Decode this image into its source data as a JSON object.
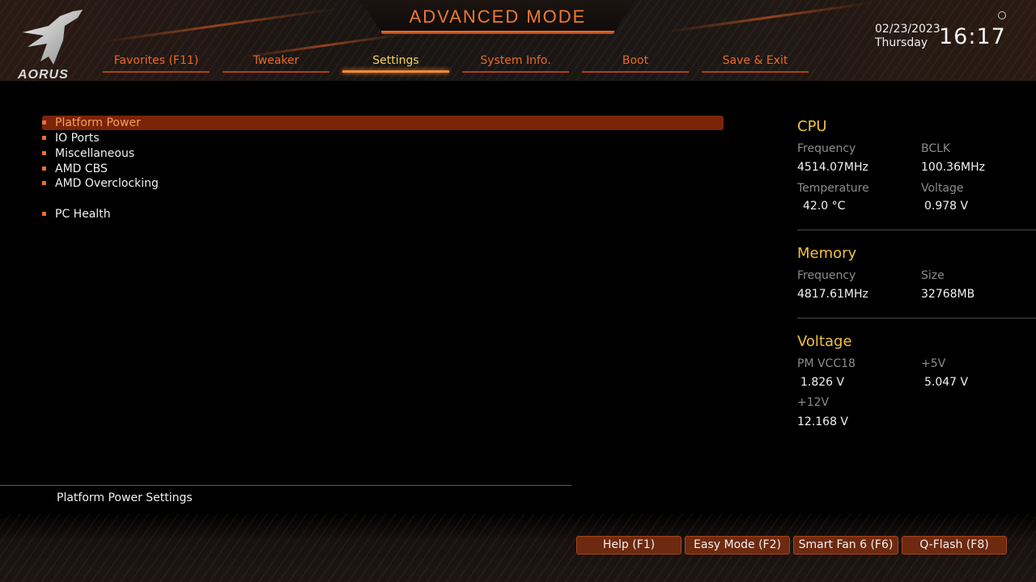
{
  "header": {
    "title": "ADVANCED MODE",
    "brand": "AORUS",
    "date": "02/23/2023",
    "day": "Thursday",
    "time": "16:17"
  },
  "tabs": [
    {
      "label": "Favorites (F11)"
    },
    {
      "label": "Tweaker"
    },
    {
      "label": "Settings",
      "active": true
    },
    {
      "label": "System Info."
    },
    {
      "label": "Boot"
    },
    {
      "label": "Save & Exit"
    }
  ],
  "menu": [
    {
      "label": "Platform Power",
      "selected": true
    },
    {
      "label": "IO Ports"
    },
    {
      "label": "Miscellaneous"
    },
    {
      "label": "AMD CBS"
    },
    {
      "label": "AMD Overclocking"
    },
    {
      "label": "PC Health"
    }
  ],
  "help": "Platform Power Settings",
  "panel": {
    "cpu": {
      "title": "CPU",
      "freq_label": "Frequency",
      "freq": "4514.07MHz",
      "bclk_label": "BCLK",
      "bclk": "100.36MHz",
      "temp_label": "Temperature",
      "temp": "42.0 °C",
      "volt_label": "Voltage",
      "volt": "0.978 V"
    },
    "memory": {
      "title": "Memory",
      "freq_label": "Frequency",
      "freq": "4817.61MHz",
      "size_label": "Size",
      "size": "32768MB"
    },
    "voltage": {
      "title": "Voltage",
      "vcc18_label": "PM VCC18",
      "vcc18": "1.826 V",
      "v5_label": "+5V",
      "v5": "5.047 V",
      "v12_label": "+12V",
      "v12": "12.168 V"
    }
  },
  "footer": [
    {
      "label": "Help (F1)"
    },
    {
      "label": "Easy Mode (F2)"
    },
    {
      "label": "Smart Fan 6 (F6)"
    },
    {
      "label": "Q-Flash (F8)"
    }
  ],
  "colors": {
    "accent": "#e8702a",
    "highlight": "#7a2408",
    "section_title": "#f0c040"
  }
}
